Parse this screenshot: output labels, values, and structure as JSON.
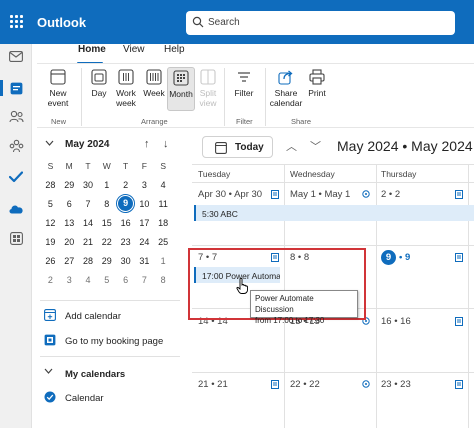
{
  "header": {
    "app_name": "Outlook",
    "search_placeholder": "Search"
  },
  "ribbon": {
    "tabs": [
      {
        "label": "Home"
      },
      {
        "label": "View"
      },
      {
        "label": "Help"
      }
    ],
    "buttons": {
      "new_event": "New event",
      "day": "Day",
      "work_week": "Work week",
      "week": "Week",
      "month": "Month",
      "split_view": "Split view",
      "filter": "Filter",
      "share_calendar": "Share calendar",
      "print": "Print"
    },
    "groups": {
      "new": "New",
      "arrange": "Arrange",
      "filter": "Filter",
      "share": "Share"
    }
  },
  "mini_calendar": {
    "title": "May 2024",
    "weekday_headers": [
      "S",
      "M",
      "T",
      "W",
      "T",
      "F",
      "S"
    ],
    "rows": [
      [
        "28",
        "29",
        "30",
        "1",
        "2",
        "3",
        "4"
      ],
      [
        "5",
        "6",
        "7",
        "8",
        "9",
        "10",
        "11"
      ],
      [
        "12",
        "13",
        "14",
        "15",
        "16",
        "17",
        "18"
      ],
      [
        "19",
        "20",
        "21",
        "22",
        "23",
        "24",
        "25"
      ],
      [
        "26",
        "27",
        "28",
        "29",
        "30",
        "31",
        "1"
      ],
      [
        "2",
        "3",
        "4",
        "5",
        "6",
        "7",
        "8"
      ]
    ],
    "today": "9"
  },
  "sidebar": {
    "add_calendar": "Add calendar",
    "booking_page": "Go to my booking page",
    "my_calendars": "My calendars",
    "calendar": "Calendar"
  },
  "toolbar": {
    "today": "Today",
    "month_title": "May 2024 • May 2024"
  },
  "calendar": {
    "weekdays": [
      "Tuesday",
      "Wednesday",
      "Thursday"
    ],
    "row1": {
      "tue": "Apr 30 • Apr 30",
      "wed": "May 1 • May 1",
      "thu": "2 • 2"
    },
    "row2": {
      "tue": "7 • 7",
      "wed": "8 • 8",
      "thu_badge": "9",
      "thu": "• 9"
    },
    "row3": {
      "tue": "14 • 14",
      "wed": "15 • 15",
      "thu": "16 • 16"
    },
    "row4": {
      "tue": "21 • 21",
      "wed": "22 • 22",
      "thu": "23 • 23"
    },
    "events": {
      "abc": "5:30 ABC",
      "power_automate": "17:00 Power Automate Discussion"
    },
    "tooltip": {
      "line1": "Power Automate Discussion",
      "line2": "from 17:00 to 17:30"
    }
  },
  "colors": {
    "brand": "#0f6cbd",
    "highlight_box": "#d13438",
    "event_fill": "#deecf9"
  }
}
